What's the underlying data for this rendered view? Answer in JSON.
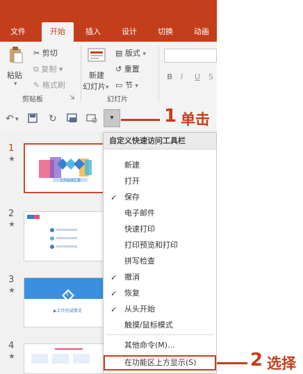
{
  "ribbon_tabs": [
    "文件",
    "开始",
    "插入",
    "设计",
    "切换",
    "动画"
  ],
  "active_tab": "开始",
  "clipboard": {
    "paste": "粘贴",
    "cut": "剪切",
    "copy": "复制",
    "format_painter": "格式刷",
    "group_label": "剪贴板"
  },
  "slides_group": {
    "new_slide_line1": "新建",
    "new_slide_line2": "幻灯片",
    "layout": "版式",
    "reset": "重置",
    "section": "节",
    "group_label": "幻灯片"
  },
  "font_buttons": [
    "B",
    "I",
    "U",
    "S"
  ],
  "qat_more_glyph": "▾",
  "slide_numbers": [
    "1",
    "2",
    "3",
    "4"
  ],
  "slide_star": "★",
  "thumb_texts": {
    "slide1_caption": "工作总结汇报",
    "slide3_caption": "工作完成情况",
    "slide3_badge": "1"
  },
  "menu": {
    "title": "自定义快速访问工具栏",
    "items": [
      {
        "label": "新建",
        "checked": false
      },
      {
        "label": "打开",
        "checked": false
      },
      {
        "label": "保存",
        "checked": true
      },
      {
        "label": "电子邮件",
        "checked": false
      },
      {
        "label": "快速打印",
        "checked": false
      },
      {
        "label": "打印预览和打印",
        "checked": false
      },
      {
        "label": "拼写检查",
        "checked": false
      },
      {
        "label": "撤消",
        "checked": true
      },
      {
        "label": "恢复",
        "checked": true
      },
      {
        "label": "从头开始",
        "checked": true
      },
      {
        "label": "触摸/鼠标模式",
        "checked": false
      }
    ],
    "more_commands": "其他命令(M)...",
    "show_below": "在功能区上方显示(S)",
    "check_glyph": "✓"
  },
  "callouts": [
    {
      "num": "1",
      "text": "单击"
    },
    {
      "num": "2",
      "text": "选择"
    }
  ],
  "colors": {
    "accent": "#c43e1c",
    "ribbon_bg": "#f3f3f3"
  }
}
